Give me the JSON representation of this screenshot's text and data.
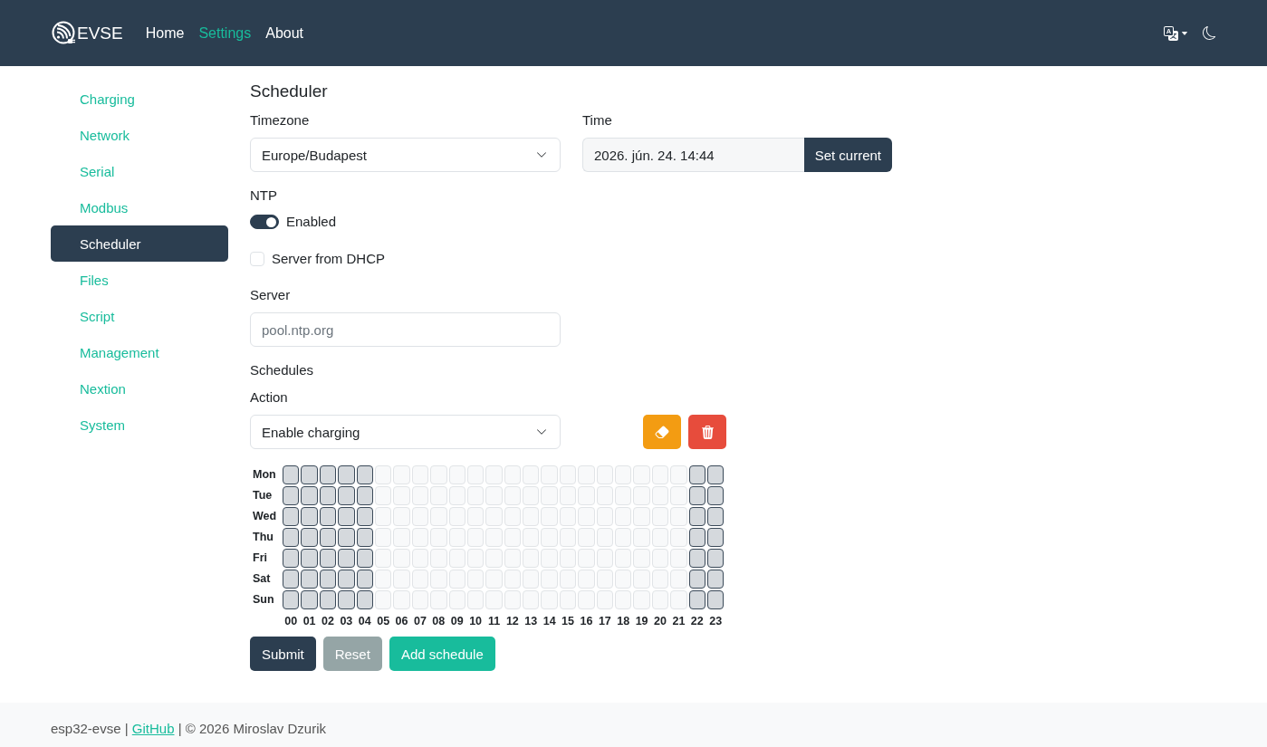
{
  "navbar": {
    "brand": "EVSE",
    "links": [
      {
        "label": "Home",
        "selected": false
      },
      {
        "label": "Settings",
        "selected": true
      },
      {
        "label": "About",
        "selected": false
      }
    ]
  },
  "sidebar": {
    "items": [
      {
        "label": "Charging",
        "selected": false
      },
      {
        "label": "Network",
        "selected": false
      },
      {
        "label": "Serial",
        "selected": false
      },
      {
        "label": "Modbus",
        "selected": false
      },
      {
        "label": "Scheduler",
        "selected": true
      },
      {
        "label": "Files",
        "selected": false
      },
      {
        "label": "Script",
        "selected": false
      },
      {
        "label": "Management",
        "selected": false
      },
      {
        "label": "Nextion",
        "selected": false
      },
      {
        "label": "System",
        "selected": false
      }
    ]
  },
  "scheduler": {
    "title": "Scheduler",
    "timezone": {
      "label": "Timezone",
      "value": "Europe/Budapest"
    },
    "time": {
      "label": "Time",
      "value": "2026. jún. 24. 14:44",
      "button": "Set current"
    },
    "ntp": {
      "label": "NTP",
      "enabled": {
        "label": "Enabled",
        "on": true
      },
      "dhcp": {
        "label": "Server from DHCP",
        "checked": false
      },
      "server": {
        "label": "Server",
        "placeholder": "pool.ntp.org"
      }
    },
    "schedules": {
      "title": "Schedules",
      "action": {
        "label": "Action",
        "value": "Enable charging"
      },
      "grid": {
        "days": [
          {
            "label": "Mon",
            "cells": [
              {
                "selected": true
              },
              {
                "selected": true
              },
              {
                "selected": true
              },
              {
                "selected": true
              },
              {
                "selected": true
              },
              {
                "selected": false
              },
              {
                "selected": false
              },
              {
                "selected": false
              },
              {
                "selected": false
              },
              {
                "selected": false
              },
              {
                "selected": false
              },
              {
                "selected": false
              },
              {
                "selected": false
              },
              {
                "selected": false
              },
              {
                "selected": false
              },
              {
                "selected": false
              },
              {
                "selected": false
              },
              {
                "selected": false
              },
              {
                "selected": false
              },
              {
                "selected": false
              },
              {
                "selected": false
              },
              {
                "selected": false
              },
              {
                "selected": true
              },
              {
                "selected": true
              }
            ]
          },
          {
            "label": "Tue",
            "cells": [
              {
                "selected": true
              },
              {
                "selected": true
              },
              {
                "selected": true
              },
              {
                "selected": true
              },
              {
                "selected": true
              },
              {
                "selected": false
              },
              {
                "selected": false
              },
              {
                "selected": false
              },
              {
                "selected": false
              },
              {
                "selected": false
              },
              {
                "selected": false
              },
              {
                "selected": false
              },
              {
                "selected": false
              },
              {
                "selected": false
              },
              {
                "selected": false
              },
              {
                "selected": false
              },
              {
                "selected": false
              },
              {
                "selected": false
              },
              {
                "selected": false
              },
              {
                "selected": false
              },
              {
                "selected": false
              },
              {
                "selected": false
              },
              {
                "selected": true
              },
              {
                "selected": true
              }
            ]
          },
          {
            "label": "Wed",
            "cells": [
              {
                "selected": true
              },
              {
                "selected": true
              },
              {
                "selected": true
              },
              {
                "selected": true
              },
              {
                "selected": true
              },
              {
                "selected": false
              },
              {
                "selected": false
              },
              {
                "selected": false
              },
              {
                "selected": false
              },
              {
                "selected": false
              },
              {
                "selected": false
              },
              {
                "selected": false
              },
              {
                "selected": false
              },
              {
                "selected": false
              },
              {
                "selected": false
              },
              {
                "selected": false
              },
              {
                "selected": false
              },
              {
                "selected": false
              },
              {
                "selected": false
              },
              {
                "selected": false
              },
              {
                "selected": false
              },
              {
                "selected": false
              },
              {
                "selected": true
              },
              {
                "selected": true
              }
            ]
          },
          {
            "label": "Thu",
            "cells": [
              {
                "selected": true
              },
              {
                "selected": true
              },
              {
                "selected": true
              },
              {
                "selected": true
              },
              {
                "selected": true
              },
              {
                "selected": false
              },
              {
                "selected": false
              },
              {
                "selected": false
              },
              {
                "selected": false
              },
              {
                "selected": false
              },
              {
                "selected": false
              },
              {
                "selected": false
              },
              {
                "selected": false
              },
              {
                "selected": false
              },
              {
                "selected": false
              },
              {
                "selected": false
              },
              {
                "selected": false
              },
              {
                "selected": false
              },
              {
                "selected": false
              },
              {
                "selected": false
              },
              {
                "selected": false
              },
              {
                "selected": false
              },
              {
                "selected": true
              },
              {
                "selected": true
              }
            ]
          },
          {
            "label": "Fri",
            "cells": [
              {
                "selected": true
              },
              {
                "selected": true
              },
              {
                "selected": true
              },
              {
                "selected": true
              },
              {
                "selected": true
              },
              {
                "selected": false
              },
              {
                "selected": false
              },
              {
                "selected": false
              },
              {
                "selected": false
              },
              {
                "selected": false
              },
              {
                "selected": false
              },
              {
                "selected": false
              },
              {
                "selected": false
              },
              {
                "selected": false
              },
              {
                "selected": false
              },
              {
                "selected": false
              },
              {
                "selected": false
              },
              {
                "selected": false
              },
              {
                "selected": false
              },
              {
                "selected": false
              },
              {
                "selected": false
              },
              {
                "selected": false
              },
              {
                "selected": true
              },
              {
                "selected": true
              }
            ]
          },
          {
            "label": "Sat",
            "cells": [
              {
                "selected": true
              },
              {
                "selected": true
              },
              {
                "selected": true
              },
              {
                "selected": true
              },
              {
                "selected": true
              },
              {
                "selected": false
              },
              {
                "selected": false
              },
              {
                "selected": false
              },
              {
                "selected": false
              },
              {
                "selected": false
              },
              {
                "selected": false
              },
              {
                "selected": false
              },
              {
                "selected": false
              },
              {
                "selected": false
              },
              {
                "selected": false
              },
              {
                "selected": false
              },
              {
                "selected": false
              },
              {
                "selected": false
              },
              {
                "selected": false
              },
              {
                "selected": false
              },
              {
                "selected": false
              },
              {
                "selected": false
              },
              {
                "selected": true
              },
              {
                "selected": true
              }
            ]
          },
          {
            "label": "Sun",
            "cells": [
              {
                "selected": true
              },
              {
                "selected": true
              },
              {
                "selected": true
              },
              {
                "selected": true
              },
              {
                "selected": true
              },
              {
                "selected": false
              },
              {
                "selected": false
              },
              {
                "selected": false
              },
              {
                "selected": false
              },
              {
                "selected": false
              },
              {
                "selected": false
              },
              {
                "selected": false
              },
              {
                "selected": false
              },
              {
                "selected": false
              },
              {
                "selected": false
              },
              {
                "selected": false
              },
              {
                "selected": false
              },
              {
                "selected": false
              },
              {
                "selected": false
              },
              {
                "selected": false
              },
              {
                "selected": false
              },
              {
                "selected": false
              },
              {
                "selected": true
              },
              {
                "selected": true
              }
            ]
          }
        ],
        "hours": [
          "00",
          "01",
          "02",
          "03",
          "04",
          "05",
          "06",
          "07",
          "08",
          "09",
          "10",
          "11",
          "12",
          "13",
          "14",
          "15",
          "16",
          "17",
          "18",
          "19",
          "20",
          "21",
          "22",
          "23"
        ]
      }
    },
    "buttons": [
      {
        "label": "Submit",
        "kind": "primary"
      },
      {
        "label": "Reset",
        "kind": "secondary"
      },
      {
        "label": "Add schedule",
        "kind": "success"
      }
    ]
  },
  "footer": {
    "text": "esp32-evse |",
    "link": "GitHub",
    "copyright": "| © 2026 Miroslav Dzurik"
  }
}
